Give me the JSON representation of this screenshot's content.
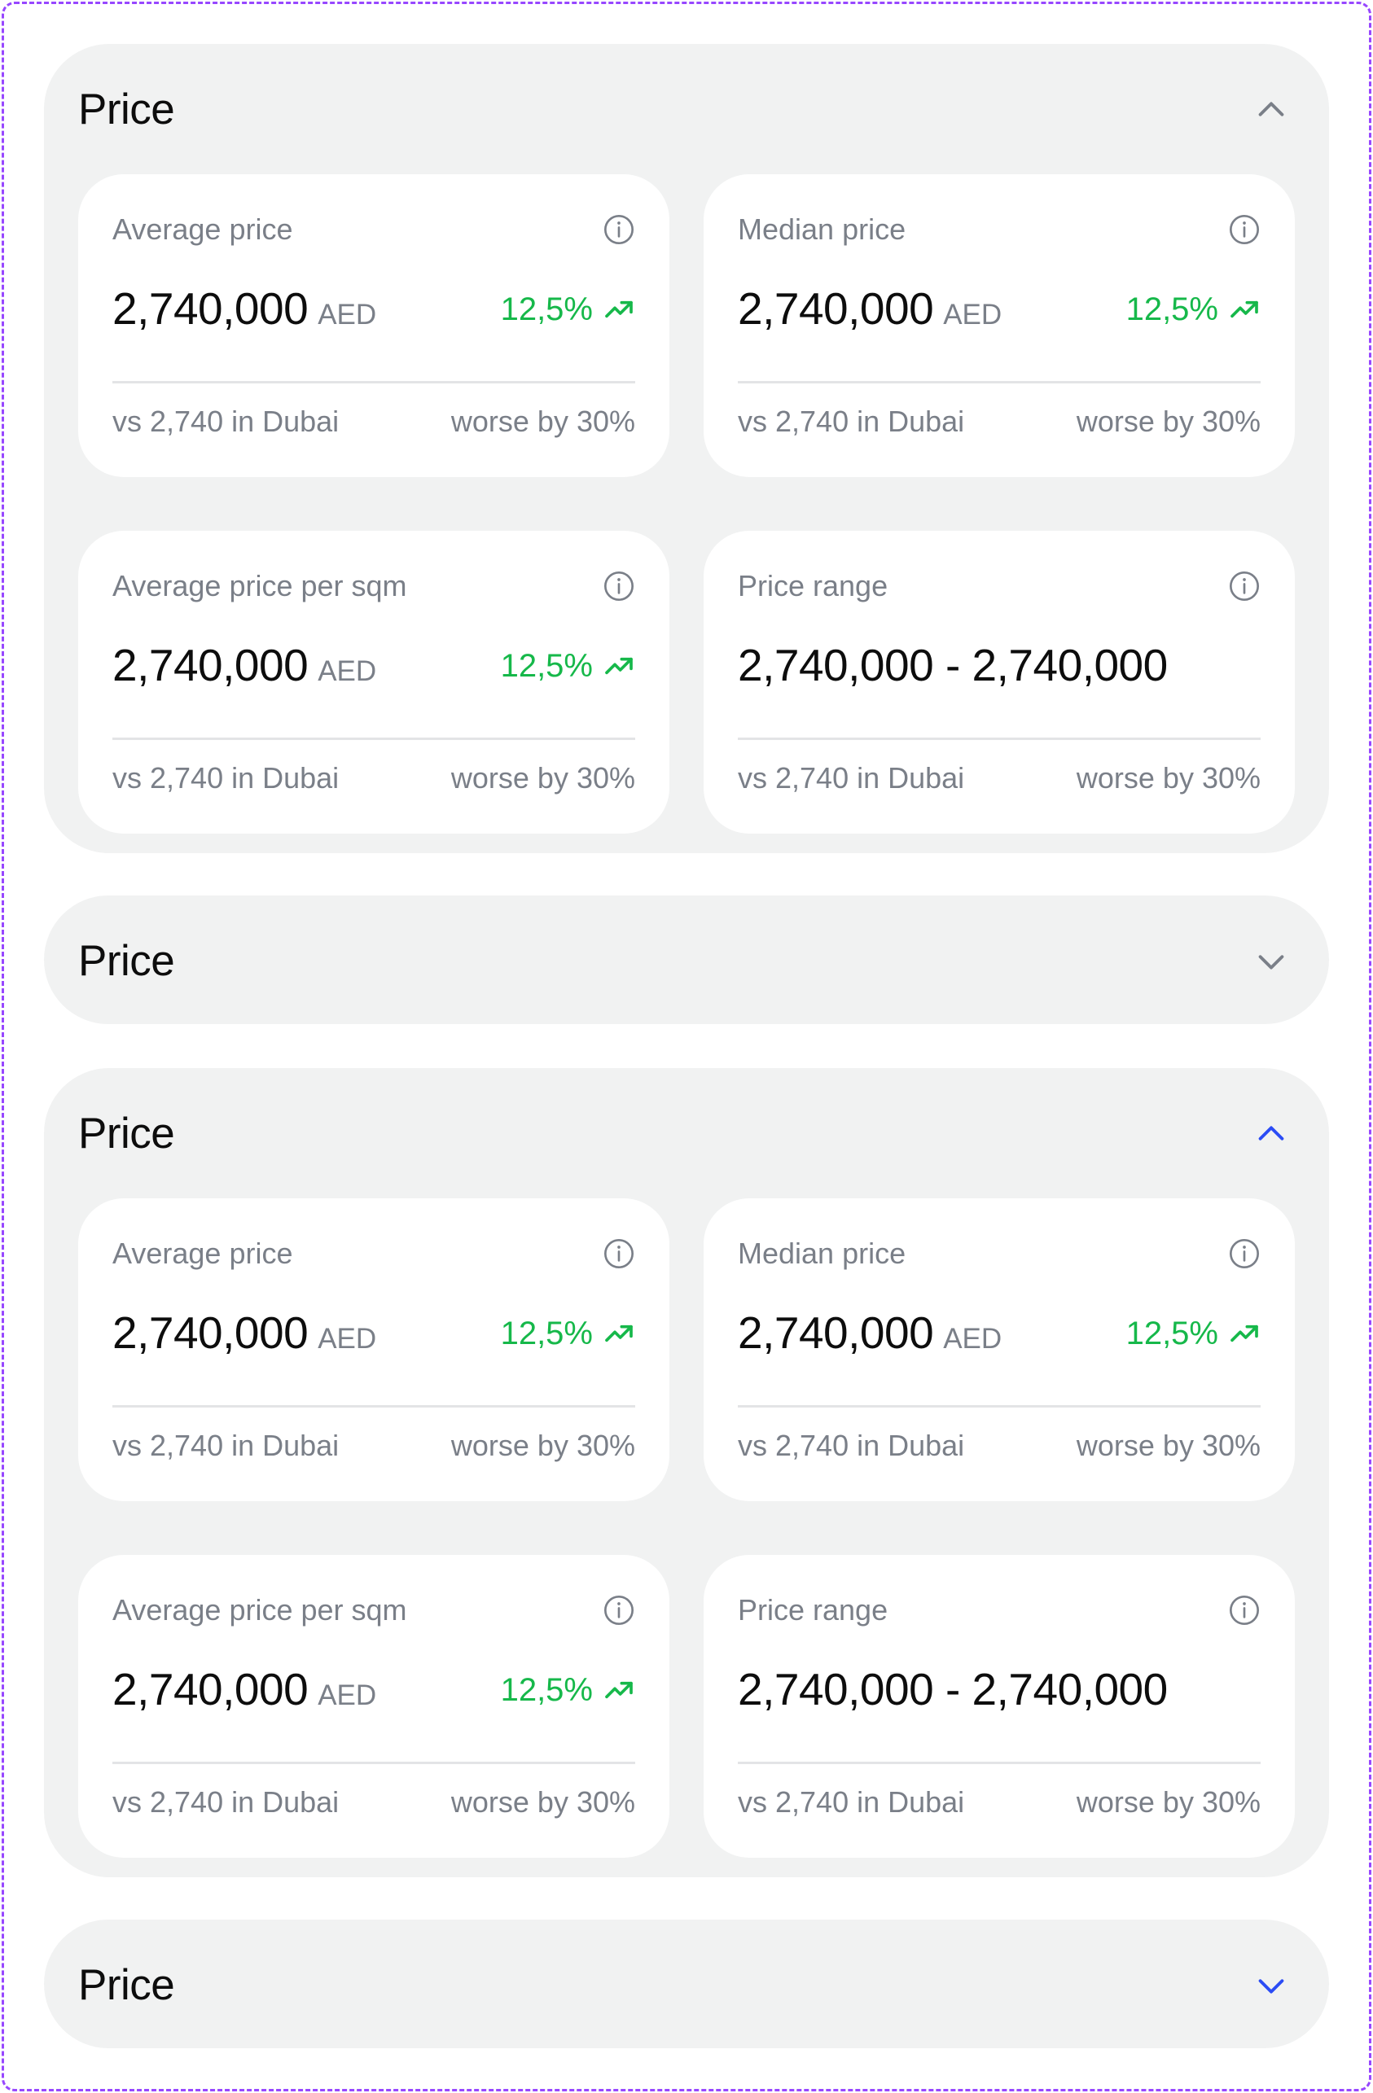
{
  "colors": {
    "positive": "#16b84a",
    "chevron_default": "#7a7f88",
    "chevron_active": "#2b4cf5",
    "frame": "#9747ff"
  },
  "sections": [
    {
      "title": "Price",
      "state": "expanded",
      "chevron_icon": "chevron-up-icon",
      "cards": [
        {
          "label": "Average price",
          "value": "2,740,000",
          "unit": "AED",
          "change": "12,5%",
          "comparison": "vs 2,740 in Dubai",
          "delta": "worse by 30%"
        },
        {
          "label": "Median price",
          "value": "2,740,000",
          "unit": "AED",
          "change": "12,5%",
          "comparison": "vs 2,740 in Dubai",
          "delta": "worse by 30%"
        },
        {
          "label": "Average price per sqm",
          "value": "2,740,000",
          "unit": "AED",
          "change": "12,5%",
          "comparison": "vs 2,740 in Dubai",
          "delta": "worse by 30%"
        },
        {
          "label": "Price range",
          "value": "2,740,000 - 2,740,000",
          "comparison": "vs 2,740 in Dubai",
          "delta": "worse by 30%"
        }
      ]
    },
    {
      "title": "Price",
      "state": "collapsed",
      "chevron_icon": "chevron-down-icon"
    },
    {
      "title": "Price",
      "state": "expanded-hover",
      "chevron_icon": "chevron-up-icon",
      "cards": [
        {
          "label": "Average price",
          "value": "2,740,000",
          "unit": "AED",
          "change": "12,5%",
          "comparison": "vs 2,740 in Dubai",
          "delta": "worse by 30%"
        },
        {
          "label": "Median price",
          "value": "2,740,000",
          "unit": "AED",
          "change": "12,5%",
          "comparison": "vs 2,740 in Dubai",
          "delta": "worse by 30%"
        },
        {
          "label": "Average price per sqm",
          "value": "2,740,000",
          "unit": "AED",
          "change": "12,5%",
          "comparison": "vs 2,740 in Dubai",
          "delta": "worse by 30%"
        },
        {
          "label": "Price range",
          "value": "2,740,000 - 2,740,000",
          "comparison": "vs 2,740 in Dubai",
          "delta": "worse by 30%"
        }
      ]
    },
    {
      "title": "Price",
      "state": "collapsed-hover",
      "chevron_icon": "chevron-down-icon"
    }
  ]
}
